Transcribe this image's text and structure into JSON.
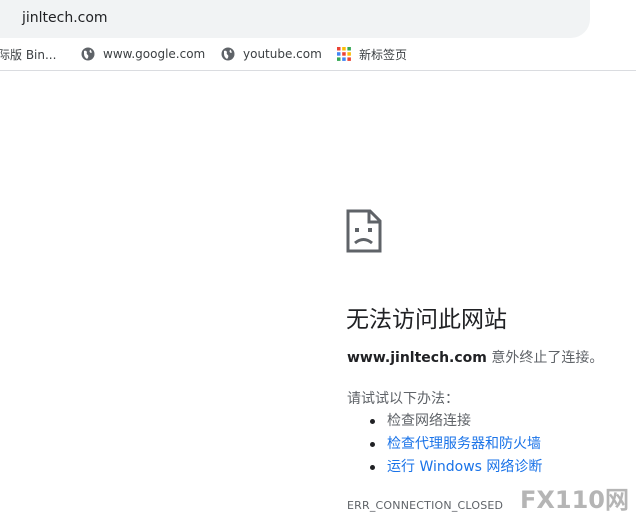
{
  "address_bar": {
    "url": "jinltech.com"
  },
  "bookmarks": [
    {
      "label": "国际版 Bin...",
      "icon": "bing-icon"
    },
    {
      "label": "www.google.com",
      "icon": "globe-icon"
    },
    {
      "label": "youtube.com",
      "icon": "globe-icon"
    },
    {
      "label": "新标签页",
      "icon": "apps-grid-icon"
    }
  ],
  "error_page": {
    "headline": "无法访问此网站",
    "host": "www.jinltech.com",
    "message": " 意外终止了连接。",
    "try_label": "请试试以下办法：",
    "suggestions": [
      {
        "text": "检查网络连接",
        "is_link": false
      },
      {
        "text": "检查代理服务器和防火墙",
        "is_link": true
      },
      {
        "text": "运行 Windows 网络诊断",
        "is_link": true
      }
    ],
    "error_code": "ERR_CONNECTION_CLOSED"
  },
  "watermark": {
    "logo_text": "FX110网"
  },
  "colors": {
    "link": "#1a73e8",
    "text": "#202124",
    "secondary": "#5f6368"
  }
}
